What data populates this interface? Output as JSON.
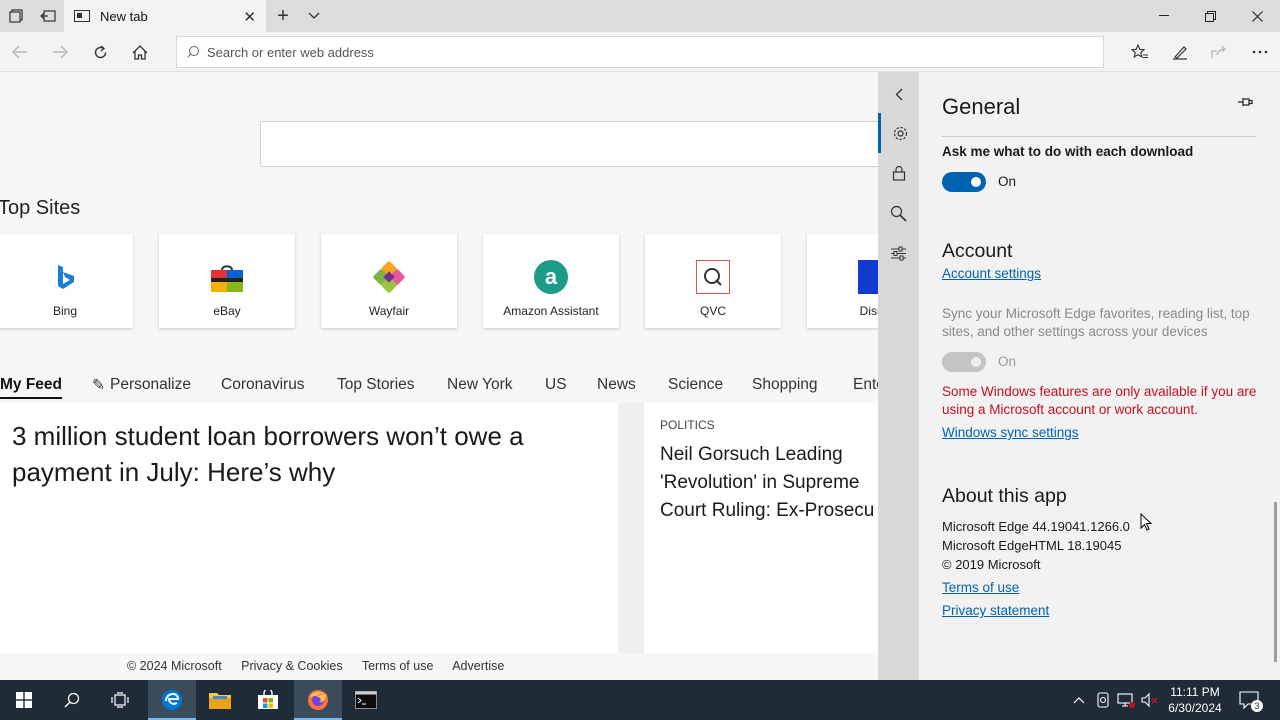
{
  "browser": {
    "tab_title": "New tab",
    "address_placeholder": "Search or enter web address"
  },
  "page": {
    "top_sites_title": "Top Sites",
    "top_sites": [
      {
        "label": "Bing"
      },
      {
        "label": "eBay"
      },
      {
        "label": "Wayfair"
      },
      {
        "label": "Amazon Assistant"
      },
      {
        "label": "QVC"
      },
      {
        "label": "Disne"
      }
    ],
    "feed_tabs": [
      "My Feed",
      "Personalize",
      "Coronavirus",
      "Top Stories",
      "New York",
      "US",
      "News",
      "Science",
      "Shopping",
      "Ente"
    ],
    "articles": [
      {
        "headline": "3 million student loan borrowers won’t owe a payment in July: Here’s why"
      },
      {
        "category": "POLITICS",
        "headline_lines": [
          "Neil Gorsuch Leading",
          "'Revolution' in Supreme",
          "Court Ruling: Ex-Prosecu"
        ]
      }
    ],
    "footer": [
      "© 2024 Microsoft",
      "Privacy & Cookies",
      "Terms of use",
      "Advertise"
    ]
  },
  "settings": {
    "title": "General",
    "download_label": "Ask me what to do with each download",
    "download_toggle_state": "On",
    "account_heading": "Account",
    "account_settings_link": "Account settings",
    "sync_text": "Sync your Microsoft Edge favorites, reading list, top sites, and other settings across your devices",
    "sync_toggle_state": "On",
    "warning_text": "Some Windows features are only available if you are using a Microsoft account or work account.",
    "windows_sync_link": "Windows sync settings",
    "about_heading": "About this app",
    "about_lines": [
      "Microsoft Edge 44.19041.1266.0",
      "Microsoft EdgeHTML 18.19045",
      "© 2019 Microsoft"
    ],
    "terms_link": "Terms of use",
    "privacy_link": "Privacy statement"
  },
  "taskbar": {
    "time": "11:11 PM",
    "date": "6/30/2024",
    "notification_count": "3"
  },
  "colors": {
    "accent": "#0063b1",
    "warning": "#c50f1f",
    "taskbar": "#1f2c38"
  }
}
